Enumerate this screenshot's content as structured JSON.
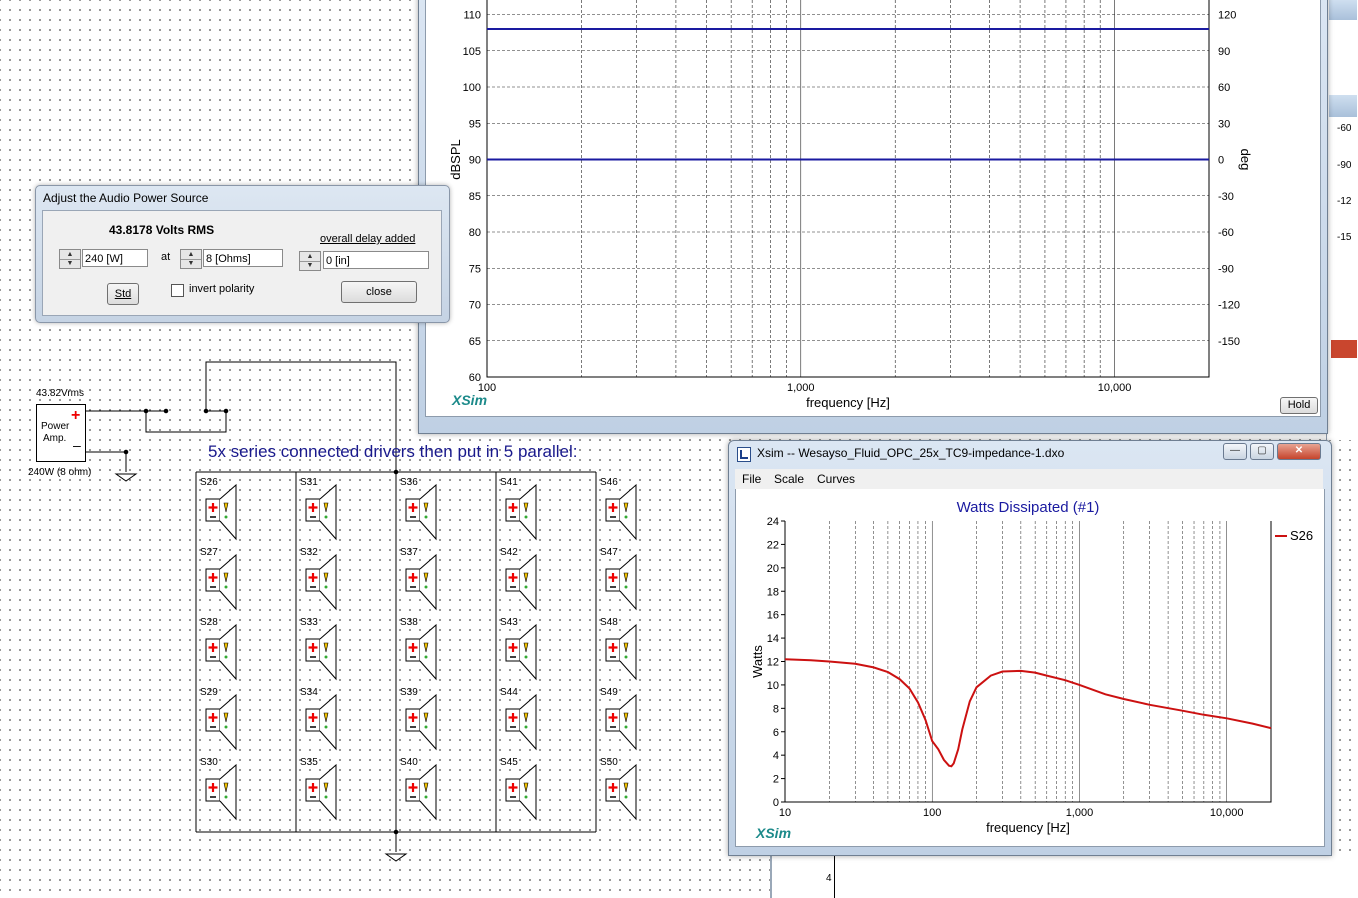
{
  "dialog": {
    "title": "Adjust the Audio Power Source",
    "volts_rms": "43.8178 Volts RMS",
    "power_value": "240 [W]",
    "at_label": "at",
    "impedance_value": "8 [Ohms]",
    "delay_label": "overall delay added",
    "delay_value": "0 [in]",
    "std_label": "Std",
    "invert_label": "invert polarity",
    "close_label": "close"
  },
  "schematic": {
    "amp_voltage": "43.82Vrms",
    "amp_label_1": "Power",
    "amp_label_2": "Amp.",
    "amp_rating": "240W (8 ohm)",
    "caption": "5x series connected drivers then put in 5 parallel:",
    "speaker_columns": [
      [
        "S26",
        "S27",
        "S28",
        "S29",
        "S30"
      ],
      [
        "S31",
        "S32",
        "S33",
        "S34",
        "S35"
      ],
      [
        "S36",
        "S37",
        "S38",
        "S39",
        "S40"
      ],
      [
        "S41",
        "S42",
        "S43",
        "S44",
        "S45"
      ],
      [
        "S46",
        "S47",
        "S48",
        "S49",
        "S50"
      ]
    ]
  },
  "spl_window": {
    "brand": "XSim",
    "hold_label": "Hold",
    "chart_data": {
      "type": "line",
      "xlabel": "frequency [Hz]",
      "ylabel": "dBSPL",
      "y2label": "deg",
      "xscale": "log",
      "xlim": [
        100,
        20000
      ],
      "ylim": [
        60,
        112
      ],
      "y2lim": [
        -180,
        132
      ],
      "x_ticks": [
        "100",
        "1,000",
        "10,000"
      ],
      "y_ticks": [
        60,
        65,
        70,
        75,
        80,
        85,
        90,
        95,
        100,
        105,
        110
      ],
      "y2_ticks": [
        -150,
        -120,
        -90,
        -60,
        -30,
        0,
        30,
        60,
        90,
        120
      ],
      "series": [
        {
          "axis": "left",
          "color": "#1a1aa0",
          "x": [
            100,
            20000
          ],
          "y": [
            108,
            108
          ]
        },
        {
          "axis": "right",
          "color": "#1a1aa0",
          "x": [
            100,
            20000
          ],
          "y": [
            0,
            0
          ]
        }
      ]
    }
  },
  "watts_window": {
    "title": "Xsim -- Wesayso_Fluid_OPC_25x_TC9-impedance-1.dxo",
    "menu": [
      "File",
      "Scale",
      "Curves"
    ],
    "brand": "XSim",
    "chart_data": {
      "type": "line",
      "title": "Watts Dissipated (#1)",
      "xlabel": "frequency [Hz]",
      "ylabel": "Watts",
      "xscale": "log",
      "xlim": [
        10,
        20000
      ],
      "ylim": [
        0,
        24
      ],
      "x_ticks": [
        "10",
        "100",
        "1,000",
        "10,000"
      ],
      "y_ticks": [
        0,
        2,
        4,
        6,
        8,
        10,
        12,
        14,
        16,
        18,
        20,
        22,
        24
      ],
      "legend": "right",
      "series": [
        {
          "name": "S26",
          "color": "#cc1111",
          "x": [
            10,
            15,
            20,
            25,
            30,
            40,
            50,
            60,
            70,
            80,
            90,
            100,
            110,
            120,
            130,
            135,
            140,
            150,
            160,
            180,
            200,
            250,
            300,
            400,
            500,
            600,
            800,
            1000,
            1500,
            2000,
            3000,
            5000,
            7000,
            10000,
            15000,
            20000
          ],
          "y": [
            12.2,
            12.1,
            12.0,
            11.9,
            11.8,
            11.5,
            11.1,
            10.5,
            9.7,
            8.5,
            7.0,
            5.2,
            4.5,
            3.6,
            3.1,
            3.05,
            3.3,
            4.5,
            6.2,
            8.6,
            9.8,
            10.8,
            11.15,
            11.2,
            11.05,
            10.8,
            10.4,
            10.0,
            9.2,
            8.8,
            8.3,
            7.8,
            7.45,
            7.15,
            6.7,
            6.3
          ]
        }
      ]
    }
  },
  "background_fragments": {
    "right_axis_ticks": [
      "-60",
      "-90",
      "-12",
      "-15"
    ],
    "bottom_tick": "4"
  }
}
